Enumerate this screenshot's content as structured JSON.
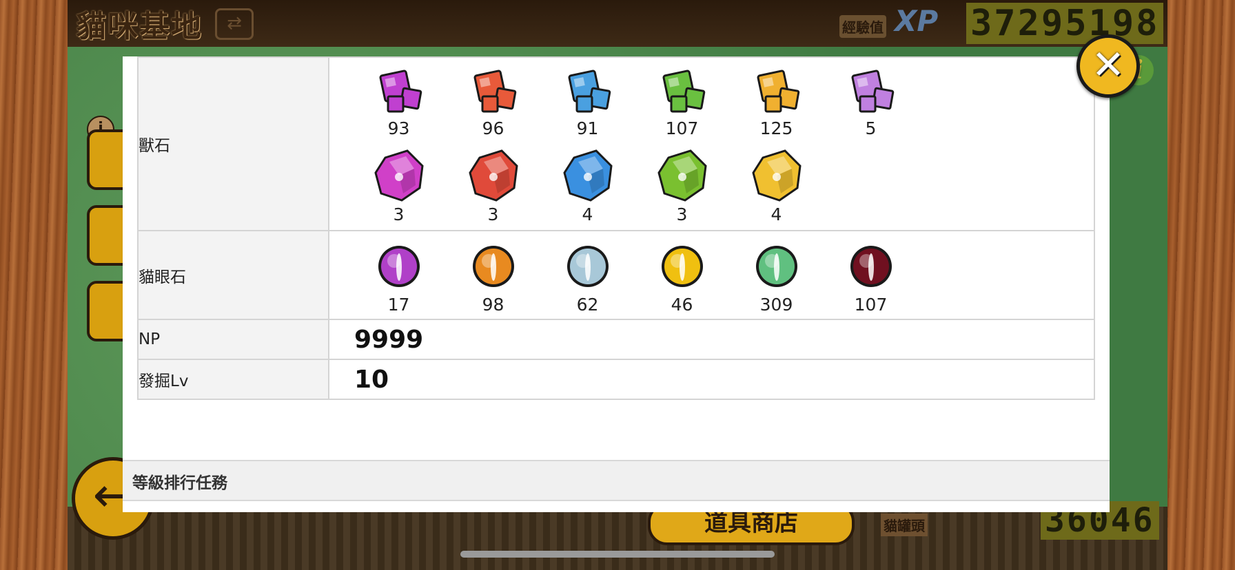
{
  "header": {
    "base_title": "貓咪基地",
    "xp_label": "經驗值",
    "xp_mark": "XP",
    "xp_value": "37295198"
  },
  "footer": {
    "shop_label": "道具商店",
    "catfood_label": "貓罐頭",
    "catfood_value": "36046"
  },
  "modal": {
    "rows": [
      {
        "label": "獸石",
        "items": [
          {
            "icon": "purple-behemoth-stone-icon",
            "color": "#c040d0",
            "count": "93"
          },
          {
            "icon": "red-behemoth-stone-icon",
            "color": "#e85a3a",
            "count": "96"
          },
          {
            "icon": "blue-behemoth-stone-icon",
            "color": "#4aa0e0",
            "count": "91"
          },
          {
            "icon": "green-behemoth-stone-icon",
            "color": "#6ac040",
            "count": "107"
          },
          {
            "icon": "yellow-behemoth-stone-icon",
            "color": "#f0b030",
            "count": "125"
          },
          {
            "icon": "rainbow-behemoth-stone-icon",
            "color": "#c080e0",
            "count": "5"
          },
          {
            "icon": "purple-behemoth-gem-icon",
            "color": "#d040c8",
            "count": "3"
          },
          {
            "icon": "red-behemoth-gem-icon",
            "color": "#e04a3a",
            "count": "3"
          },
          {
            "icon": "blue-behemoth-gem-icon",
            "color": "#3a90e0",
            "count": "4"
          },
          {
            "icon": "green-behemoth-gem-icon",
            "color": "#7ac030",
            "count": "3"
          },
          {
            "icon": "yellow-behemoth-gem-icon",
            "color": "#f0c030",
            "count": "4"
          }
        ]
      },
      {
        "label": "貓眼石",
        "items": [
          {
            "icon": "purple-catseye-icon",
            "color": "#b040c8",
            "count": "17"
          },
          {
            "icon": "orange-catseye-icon",
            "color": "#e88a20",
            "count": "98"
          },
          {
            "icon": "silver-catseye-icon",
            "color": "#a8c8d8",
            "count": "62"
          },
          {
            "icon": "gold-catseye-icon",
            "color": "#f0c010",
            "count": "46"
          },
          {
            "icon": "rainbow-catseye-icon",
            "color": "#60c080",
            "count": "309"
          },
          {
            "icon": "dark-catseye-icon",
            "color": "#701020",
            "count": "107"
          }
        ]
      }
    ],
    "np_label": "NP",
    "np_value": "9999",
    "dig_label": "發掘Lv",
    "dig_value": "10",
    "rank_section_label": "等級排行任務"
  }
}
